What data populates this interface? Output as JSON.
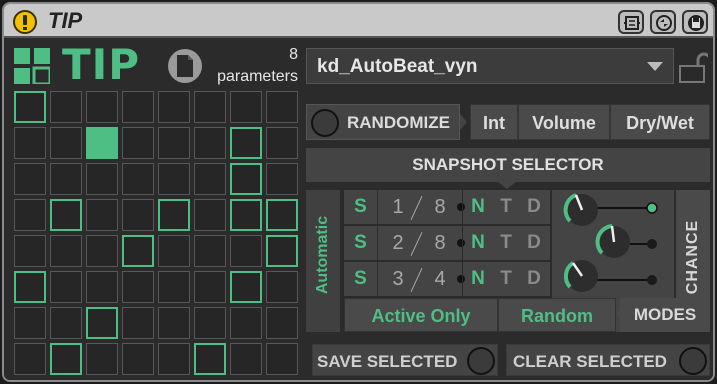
{
  "window": {
    "title": "TIP"
  },
  "logo": {
    "text": "TIP"
  },
  "parameters": {
    "count": "8",
    "label": "parameters"
  },
  "preset": {
    "name": "kd_AutoBeat_vyn"
  },
  "randomize": {
    "label": "RANDOMIZE"
  },
  "toggles": [
    {
      "label": "Int"
    },
    {
      "label": "Volume"
    },
    {
      "label": "Dry/Wet"
    }
  ],
  "snapshot": {
    "header": "SNAPSHOT SELECTOR",
    "automatic_label": "Automatic",
    "chance_label": "CHANCE"
  },
  "rows": [
    {
      "s": "S",
      "a": "1",
      "b": "8",
      "n": "N",
      "t": "T",
      "d": "D",
      "active": "N",
      "knob_level": 0.3
    },
    {
      "s": "S",
      "a": "2",
      "b": "8",
      "n": "N",
      "t": "T",
      "d": "D",
      "active": "N",
      "knob_level": 0.35
    },
    {
      "s": "S",
      "a": "3",
      "b": "4",
      "n": "N",
      "t": "T",
      "d": "D",
      "active": "N",
      "knob_level": 0.25
    }
  ],
  "modes": {
    "active_only": "Active Only",
    "random": "Random",
    "label": "MODES"
  },
  "actions": {
    "save": "SAVE SELECTED",
    "clear": "CLEAR SELECTED"
  },
  "grid": {
    "cols": 8,
    "rows": 8,
    "cells": [
      "o.......",
      "..F...o.",
      "......o.",
      ".o..o.oo",
      "...o...o",
      "o.....o.",
      "..o.....",
      ".o...o.."
    ]
  },
  "colors": {
    "accent": "#4fbe84",
    "power": "#f2c200"
  }
}
